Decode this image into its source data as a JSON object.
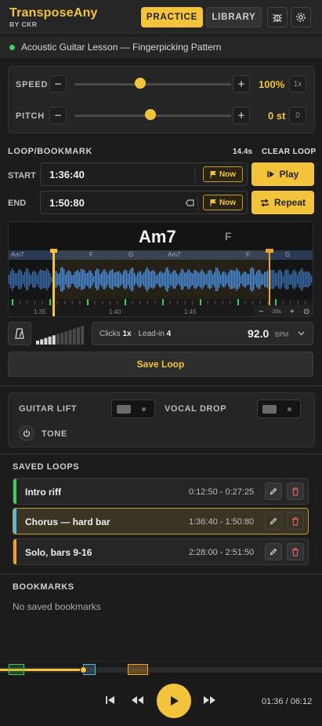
{
  "header": {
    "brand": "TransposeAny",
    "brand_sub": "BY CKR",
    "tab_practice": "PRACTICE",
    "tab_library": "LIBRARY",
    "icons": [
      "bug-icon",
      "settings-icon"
    ]
  },
  "lesson": {
    "title": "Acoustic Guitar Lesson — Fingerpicking Pattern"
  },
  "speed": {
    "label": "SPEED",
    "value": "100%",
    "reset": "1x",
    "level": 0.5
  },
  "pitch": {
    "label": "PITCH",
    "value": "0 st",
    "reset": "0",
    "level": 0.5
  },
  "loop": {
    "title": "LOOP/BOOKMARK",
    "duration": "14.4s",
    "clear": "CLEAR LOOP",
    "start_label": "START",
    "start_value": "1:36:40",
    "end_label": "END",
    "end_value": "1:50:80",
    "now_label": "Now",
    "play_label": "Play",
    "repeat_label": "Repeat"
  },
  "waveform": {
    "current_chord": "Am7",
    "next_chord": "F",
    "strip_chords": [
      "Am7",
      "F",
      "G",
      "Am7",
      "F",
      "G"
    ],
    "time_labels": [
      "1:35",
      "1:40",
      "1:45"
    ],
    "zoom": "20s"
  },
  "metronome": {
    "clicks_label": "Clicks",
    "clicks_value": "1x",
    "leadin_label": "Lead-in",
    "leadin_value": "4",
    "bpm_value": "92.0",
    "bpm_unit": "BPM"
  },
  "save_loop": "Save Loop",
  "mixer": {
    "guitar_lift": "GUITAR LIFT",
    "vocal_drop": "VOCAL DROP",
    "tone": "TONE"
  },
  "saved_loops": {
    "title": "SAVED LOOPS",
    "items": [
      {
        "name": "Intro riff",
        "range": "0:12:50 - 0:27:25",
        "color": "#3ecf5a"
      },
      {
        "name": "Chorus — hard bar",
        "range": "1:36:40 - 1:50:80",
        "color": "#5ab8e6"
      },
      {
        "name": "Solo, bars 9-16",
        "range": "2:28:00 - 2:51:50",
        "color": "#f3a12b"
      }
    ]
  },
  "bookmarks": {
    "title": "BOOKMARKS",
    "empty": "No saved bookmarks"
  },
  "transport": {
    "time": "01:36 / 06:12",
    "progress": 0.26
  },
  "colors": {
    "accent": "#f3c43b",
    "background": "#1c1c1c",
    "delete": "#e05a5a"
  }
}
